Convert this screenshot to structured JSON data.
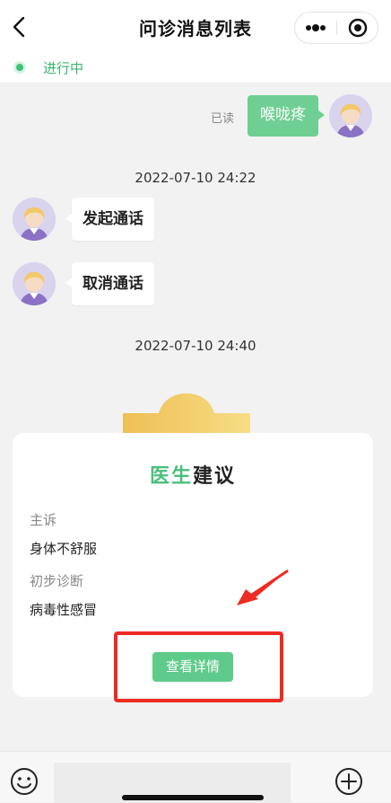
{
  "nav": {
    "title": "问诊消息列表"
  },
  "status": {
    "text": "进行中"
  },
  "messages": {
    "mine": {
      "read_label": "已读",
      "text": "喉咙疼"
    },
    "time1": "2022-07-10 24:22",
    "incoming": [
      {
        "text": "发起通话"
      },
      {
        "text": "取消通话"
      }
    ],
    "time2": "2022-07-10 24:40"
  },
  "card": {
    "title_green": "医生",
    "title_dark": "建议",
    "complaint_label": "主诉",
    "complaint_value": "身体不舒服",
    "diagnosis_label": "初步诊断",
    "diagnosis_value": "病毒性感冒",
    "detail_button": "查看详情"
  },
  "input": {
    "placeholder": ""
  },
  "colors": {
    "accent_green": "#6fcf93",
    "status_green": "#3fc27a",
    "highlight_red": "#ee2b22",
    "deco_gold": "#f0c45c"
  },
  "icons": {
    "back": "chevron-left-icon",
    "more": "more-dots-icon",
    "close": "target-close-icon",
    "emoji": "smiley-icon",
    "plus": "plus-circle-icon"
  }
}
